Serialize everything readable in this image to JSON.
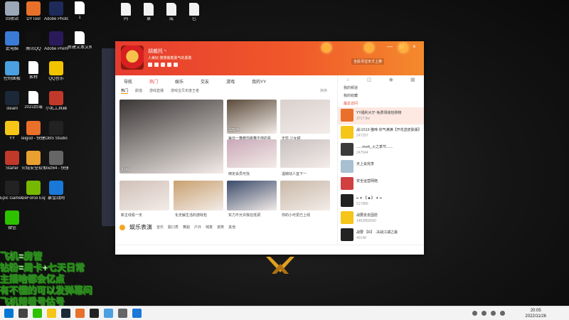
{
  "desktop": {
    "icons": [
      {
        "label": "回收站",
        "color": "#9aa8b8",
        "type": "app"
      },
      {
        "label": "DYTool",
        "color": "#e8702a",
        "type": "app"
      },
      {
        "label": "Adobe Photosh...",
        "color": "#1e2a5a",
        "type": "app"
      },
      {
        "label": "1",
        "color": "#ffffff",
        "type": "file"
      },
      {
        "label": "此电脑",
        "color": "#3a7bd5",
        "type": "app"
      },
      {
        "label": "腾讯QQ",
        "color": "#111111",
        "type": "app"
      },
      {
        "label": "Adobe Premie...",
        "color": "#2a1a5a",
        "type": "app"
      },
      {
        "label": "新建文本文档",
        "color": "#ffffff",
        "type": "file"
      },
      {
        "label": "控制面板",
        "color": "#4aa0e0",
        "type": "app"
      },
      {
        "label": "素材",
        "color": "#ffffff",
        "type": "file"
      },
      {
        "label": "QQ音乐",
        "color": "#f2c400",
        "type": "app"
      },
      {
        "label": "steam",
        "color": "#1b2838",
        "type": "app"
      },
      {
        "label": "2022后端",
        "color": "#ffffff",
        "type": "file"
      },
      {
        "label": "小乳工具箱",
        "color": "#c0392b",
        "type": "app"
      },
      {
        "label": "YY",
        "color": "#f5c518",
        "type": "app"
      },
      {
        "label": "leigod - 快捷方式",
        "color": "#e8702a",
        "type": "app"
      },
      {
        "label": "OBS Studio",
        "color": "#222222",
        "type": "app"
      },
      {
        "label": "Starter",
        "color": "#c0392b",
        "type": "app"
      },
      {
        "label": "火绒安全软件",
        "color": "#e8a030",
        "type": "app"
      },
      {
        "label": "Dwz64 - 快捷方式",
        "color": "#666666",
        "type": "app"
      },
      {
        "label": "Epic Games Launcher",
        "color": "#222222",
        "type": "app"
      },
      {
        "label": "GeForce Experience",
        "color": "#76b900",
        "type": "app"
      },
      {
        "label": "暴雪战网",
        "color": "#1a78d8",
        "type": "app"
      },
      {
        "label": "微信",
        "color": "#2dc100",
        "type": "app"
      }
    ],
    "top_files": [
      "内",
      "录",
      "成",
      "已"
    ]
  },
  "app": {
    "user": {
      "name": "胡裁托丶",
      "signature": "人美好,慢慢做着勇气的勇敢"
    },
    "banner": "全民寻宝天才上架",
    "window_controls": [
      "—",
      "□",
      "×"
    ],
    "nav": [
      "导航",
      "热门",
      "娱乐",
      "交友",
      "游戏",
      "我的YY"
    ],
    "nav_active": 1,
    "sub_tabs": [
      "热门",
      "颜值",
      "游戏直播",
      "游戏宝贝年度王者"
    ],
    "refresh_label": "换换",
    "tiles": [
      {
        "caption": "",
        "viewers": "1.0w",
        "stat": "3014",
        "color": "#3a3636"
      },
      {
        "caption": "每日一舞教你跳舞不停的看",
        "viewers": "12574",
        "color": "#5a4a3a"
      },
      {
        "caption": "无忧·少女甜",
        "viewers": "",
        "color": "#d9d0cc"
      },
      {
        "caption": "绑定会员可找",
        "viewers": "",
        "color": "#c9a8b8"
      },
      {
        "caption": "温婉动人宜下一",
        "viewers": "",
        "color": "#c8c0c0"
      },
      {
        "caption": "新主线看一天",
        "viewers": "",
        "color": "#d0c0b8"
      },
      {
        "caption": "化无解生活的游戏包",
        "viewers": "",
        "color": "#c8a070"
      },
      {
        "caption": "实力不允许我在低调",
        "viewers": "",
        "color": "#3a4a6a"
      },
      {
        "caption": "你的小可爱已上线",
        "viewers": "",
        "color": "#c8b8a8"
      }
    ],
    "section": {
      "title": "娱乐表演",
      "tabs": [
        "音乐",
        "脱口秀",
        "舞蹈",
        "户外",
        "喊麦",
        "搞笑",
        "其他"
      ]
    },
    "right_panel": {
      "tabs": [
        "⌂",
        "◫",
        "◉",
        "▦"
      ],
      "menu": [
        "我的频道",
        "我的收藏",
        "最近访问"
      ],
      "rooms": [
        {
          "title": "YY福利大厅·免费领钱包购物",
          "count": "3717.8w",
          "color": "#e8702a",
          "selected": true
        },
        {
          "title": "战斗513-猫咪·欣气满满【开花送皮肤版】",
          "count": "247297",
          "color": "#f5c518"
        },
        {
          "title": "......mvrk_火之季节.......",
          "count": "247544",
          "color": "#3a3a3a"
        },
        {
          "title": "天上会完李",
          "count": "",
          "color": "#a8c0d0"
        },
        {
          "title": "安全运营网络",
          "count": "",
          "color": "#d04040"
        },
        {
          "title": "━ ✦ 【 ■ 】 ✦ ━",
          "count": "517889",
          "color": "#222222"
        },
        {
          "title": "战要去去因愿",
          "count": "1462850000",
          "color": "#f5c518"
        },
        {
          "title": "战要 【R】 ·决战江湖之最",
          "count": "49148",
          "color": "#222222"
        }
      ]
    }
  },
  "overlay": [
    "飞机=房管",
    "钻粉=周卡+七天日常",
    "主播啥都会亿点",
    "有不懂的可以发弹幕问",
    "飞机帮看号估号"
  ],
  "taskbar": {
    "time": "20:05",
    "date": "2022/11/26"
  }
}
